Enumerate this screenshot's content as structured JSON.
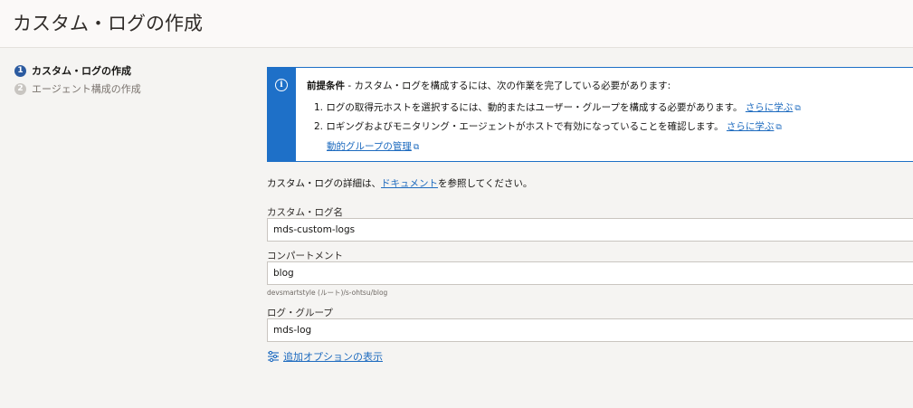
{
  "header": {
    "title": "カスタム・ログの作成"
  },
  "steps": [
    {
      "num": "1",
      "label": "カスタム・ログの作成"
    },
    {
      "num": "2",
      "label": "エージェント構成の作成"
    }
  ],
  "info": {
    "icon": "info-icon",
    "prereq_bold": "前提条件",
    "prereq_text": " - カスタム・ログを構成するには、次の作業を完了している必要があります:",
    "items": [
      {
        "text": "1. ログの取得元ホストを選択するには、動的またはユーザー・グループを構成する必要があります。",
        "link": "さらに学ぶ"
      },
      {
        "text": "2. ロギングおよびモニタリング・エージェントがホストで有効になっていることを確認します。",
        "link": "さらに学ぶ"
      }
    ],
    "mgmt_link": "動的グループの管理"
  },
  "details": {
    "prefix": "カスタム・ログの詳細は、",
    "link": "ドキュメント",
    "suffix": "を参照してください。"
  },
  "form": {
    "custom_log_name": {
      "label": "カスタム・ログ名",
      "value": "mds-custom-logs"
    },
    "compartment": {
      "label": "コンパートメント",
      "value": "blog",
      "hint": "devsmartstyle (ルート)/s-ohtsu/blog"
    },
    "log_group": {
      "label": "ログ・グループ",
      "value": "mds-log"
    },
    "more_options": "追加オプションの表示"
  },
  "colors": {
    "accent": "#1e70c8",
    "link": "#1e6bbf",
    "active_step": "#2c5ba0"
  }
}
